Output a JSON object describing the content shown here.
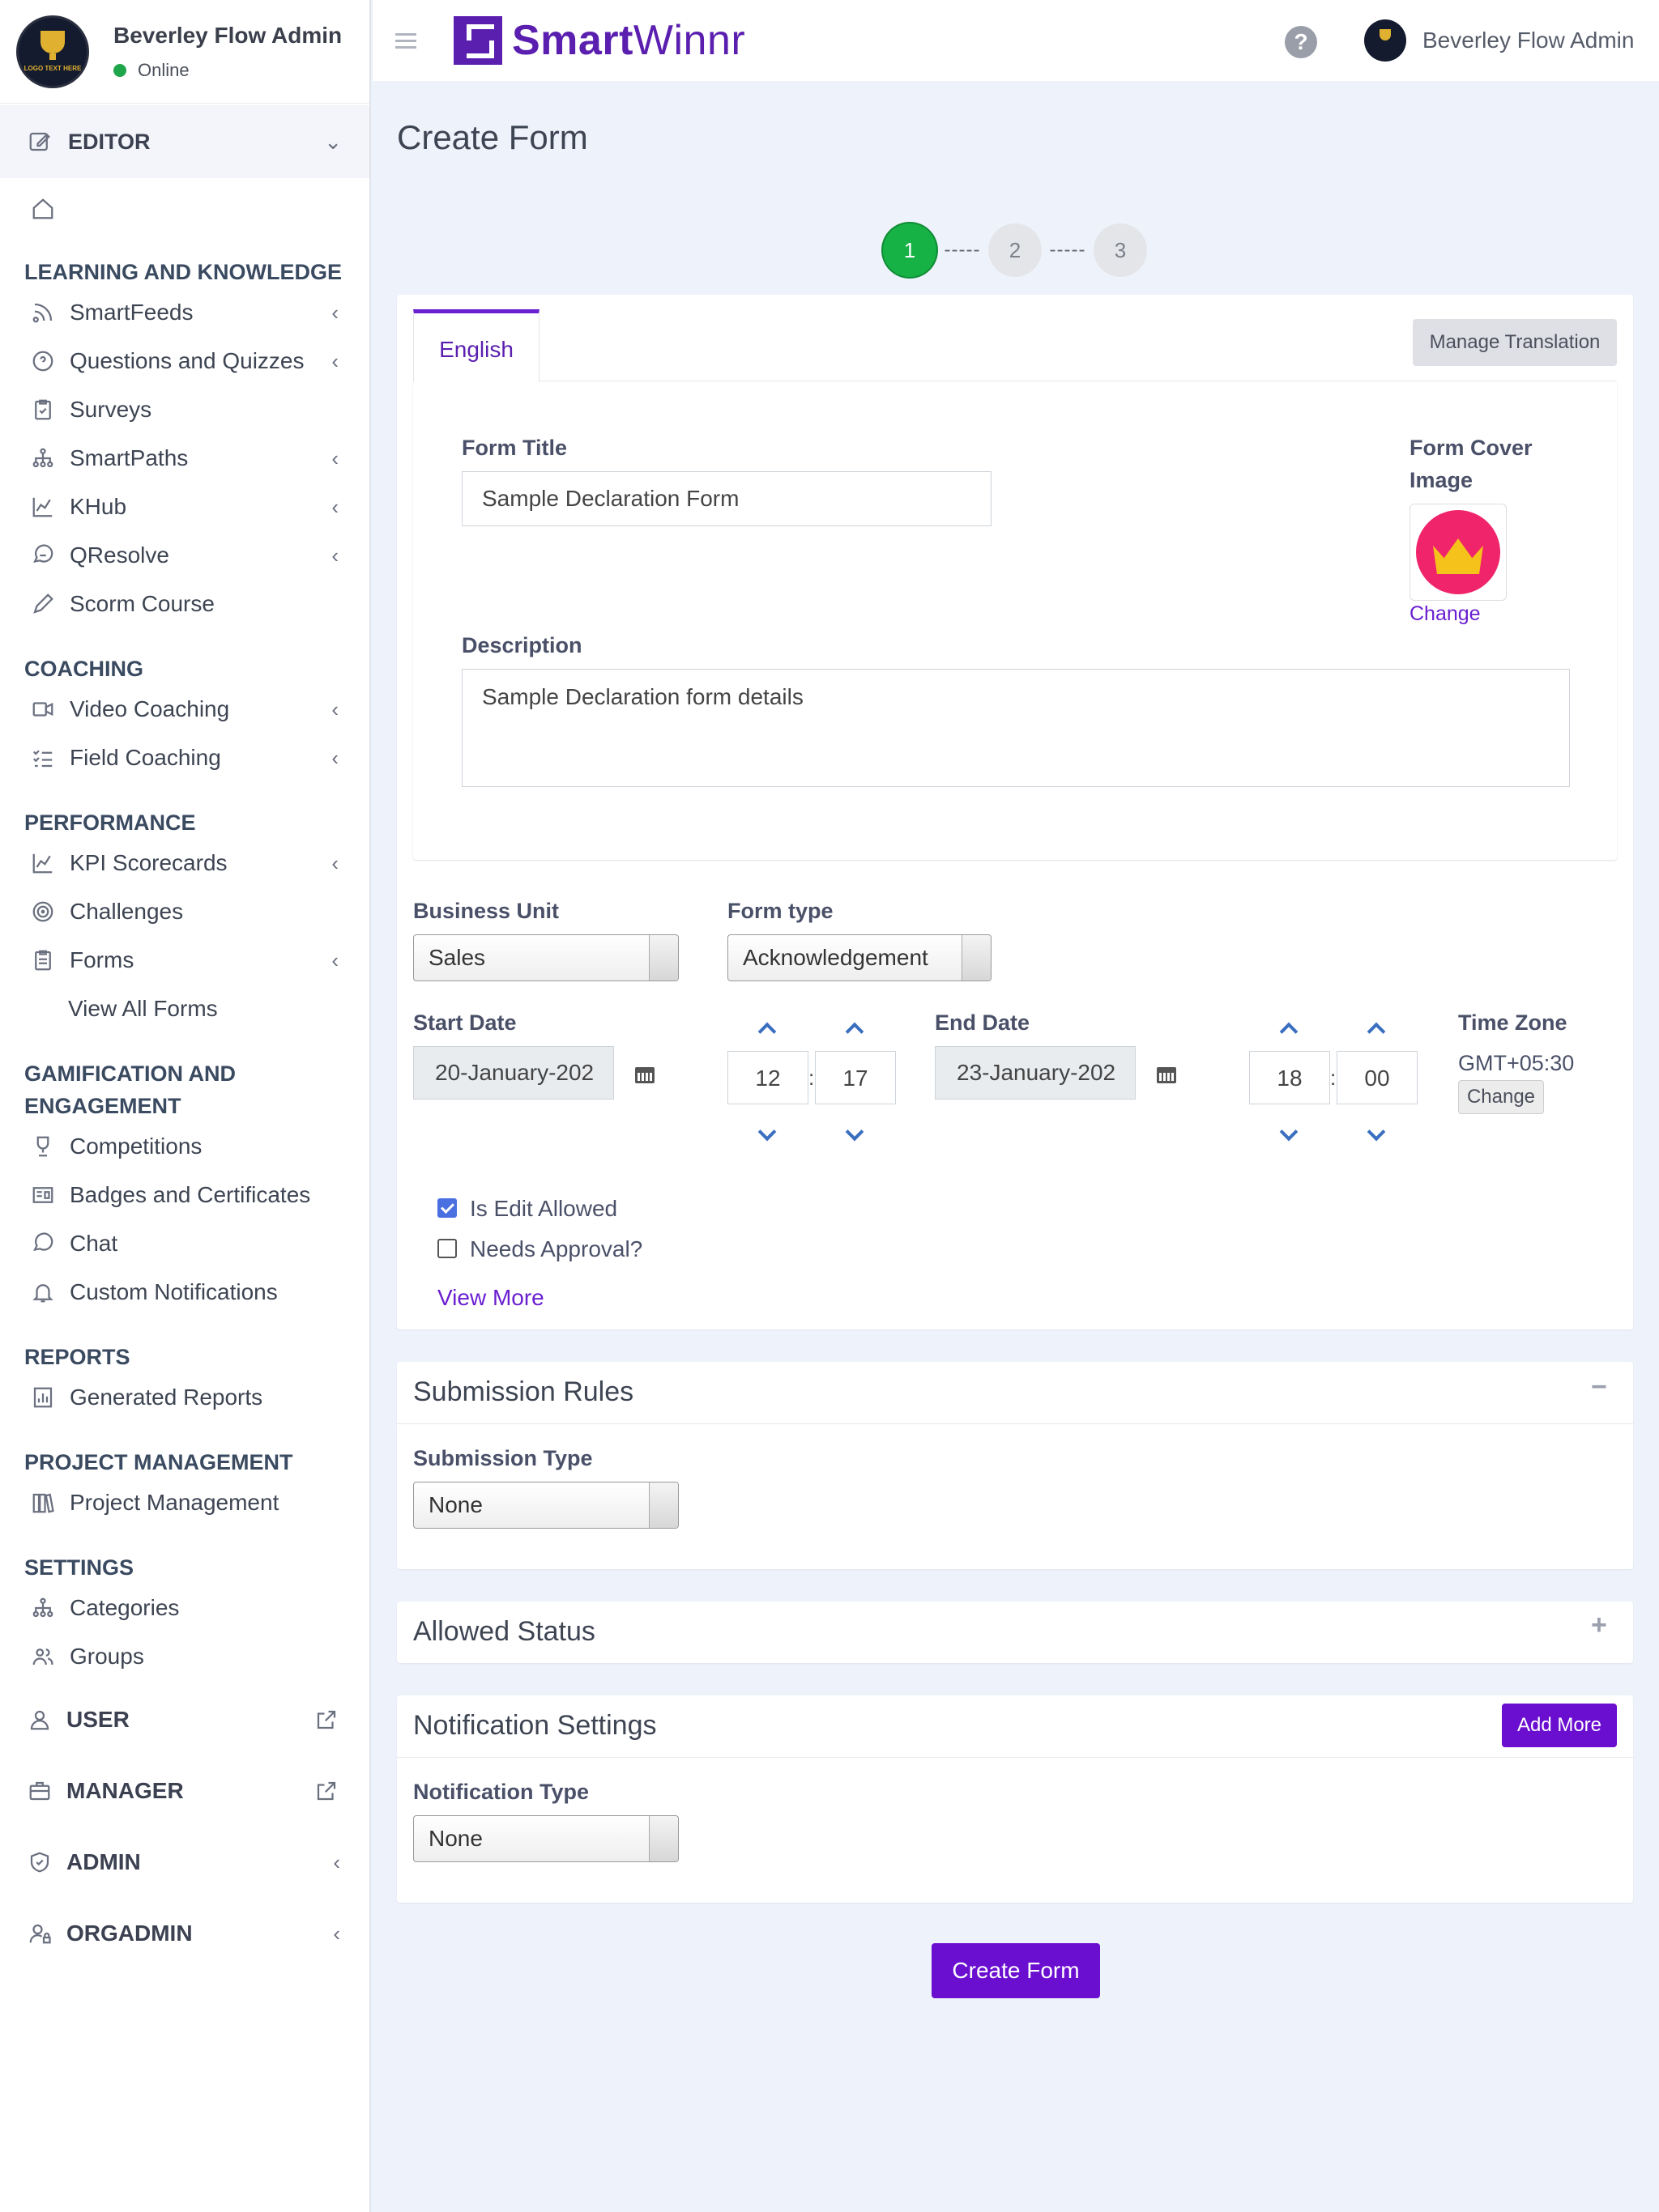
{
  "sidebar": {
    "user_name": "Beverley Flow Admin",
    "status": "Online",
    "logo_text": "LOGO TEXT HERE",
    "editor_label": "EDITOR",
    "dashboard": "Dashboard",
    "sections": {
      "learning": "LEARNING AND KNOWLEDGE",
      "coaching": "COACHING",
      "performance": "PERFORMANCE",
      "gamification_1": "GAMIFICATION AND",
      "gamification_2": "ENGAGEMENT",
      "reports": "REPORTS",
      "project": "PROJECT MANAGEMENT",
      "settings": "SETTINGS"
    },
    "items": {
      "smartfeeds": "SmartFeeds",
      "questions": "Questions and Quizzes",
      "surveys": "Surveys",
      "smartpaths": "SmartPaths",
      "khub": "KHub",
      "qresolve": "QResolve",
      "scorm": "Scorm Course",
      "video_coaching": "Video Coaching",
      "field_coaching": "Field Coaching",
      "kpi": "KPI Scorecards",
      "challenges": "Challenges",
      "forms": "Forms",
      "view_all_forms": "View All Forms",
      "competitions": "Competitions",
      "badges": "Badges and Certificates",
      "chat": "Chat",
      "custom_notifications": "Custom Notifications",
      "generated_reports": "Generated Reports",
      "project_management": "Project Management",
      "categories": "Categories",
      "groups": "Groups"
    },
    "roles": {
      "user": "USER",
      "manager": "MANAGER",
      "admin": "ADMIN",
      "orgadmin": "ORGADMIN"
    }
  },
  "header": {
    "brand_smart": "Smart",
    "brand_winnr": "Winnr",
    "help": "?",
    "user_name": "Beverley Flow Admin"
  },
  "page": {
    "title": "Create Form",
    "steps": [
      "1",
      "2",
      "3"
    ],
    "step_sep": "-----",
    "active_step": 1
  },
  "form": {
    "tab_english": "English",
    "manage_translation": "Manage Translation",
    "title_label": "Form Title",
    "title_value": "Sample Declaration Form",
    "cover_label_1": "Form Cover",
    "cover_label_2": "Image",
    "cover_change": "Change",
    "description_label": "Description",
    "description_value": "Sample Declaration form details",
    "business_unit_label": "Business Unit",
    "business_unit_value": "Sales",
    "form_type_label": "Form type",
    "form_type_value": "Acknowledgement",
    "start_date_label": "Start Date",
    "start_date_value": "20-January-202",
    "start_hour": "12",
    "start_minute": "17",
    "end_date_label": "End Date",
    "end_date_value": "23-January-202",
    "end_hour": "18",
    "end_minute": "00",
    "time_colon": ":",
    "timezone_label": "Time Zone",
    "timezone_value": "GMT+05:30",
    "timezone_change": "Change",
    "edit_allowed_label": "Is Edit Allowed",
    "edit_allowed": true,
    "needs_approval_label": "Needs Approval?",
    "needs_approval": false,
    "view_more": "View More"
  },
  "submission_rules": {
    "title": "Submission Rules",
    "toggle": "−",
    "type_label": "Submission Type",
    "type_value": "None"
  },
  "allowed_status": {
    "title": "Allowed Status",
    "toggle": "+"
  },
  "notification_settings": {
    "title": "Notification Settings",
    "add_more": "Add More",
    "type_label": "Notification Type",
    "type_value": "None"
  },
  "actions": {
    "create_form": "Create Form"
  },
  "colors": {
    "brand": "#5b1fb0",
    "button_purple": "#6a0ed0",
    "active_step": "#17b246",
    "online": "#1fa64a",
    "page_bg": "#eef2fb"
  }
}
